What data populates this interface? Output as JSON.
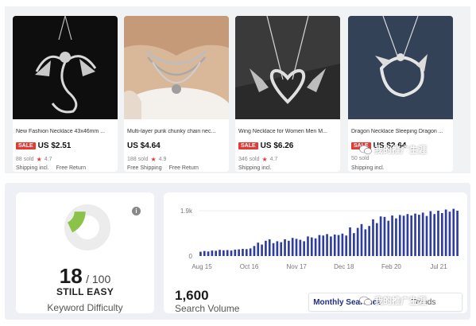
{
  "products": [
    {
      "title": "New Fashion Necklace 43x46mm ...",
      "sale": true,
      "sale_label": "SALE",
      "price": "US $2.51",
      "sold": "88 sold",
      "rating": "4.7",
      "shipping": "Shipping incl.",
      "free_return": "Free Return"
    },
    {
      "title": "Multi-layer punk chunky chain nec...",
      "sale": false,
      "sale_label": "",
      "price": "US $4.64",
      "sold": "188 sold",
      "rating": "4.9",
      "shipping": "Free Shipping",
      "free_return": "Free Return"
    },
    {
      "title": "Wing Necklace for Women Men M...",
      "sale": true,
      "sale_label": "SALE",
      "price": "US $6.26",
      "sold": "346 sold",
      "rating": "4.7",
      "shipping": "Shipping incl.",
      "free_return": ""
    },
    {
      "title": "Dragon Necklace Sleeping Dragon ...",
      "sale": true,
      "sale_label": "SALE",
      "price": "US $2.64",
      "sold": "50 sold",
      "rating": "",
      "shipping": "Shipping incl.",
      "free_return": ""
    }
  ],
  "keyword_difficulty": {
    "score": "18",
    "max": "/ 100",
    "level": "STILL EASY",
    "title": "Keyword Difficulty",
    "info_icon": "info-icon",
    "gauge_fraction": 0.18,
    "gauge_color": "#8bc34a"
  },
  "search_volume": {
    "value": "1,600",
    "title": "Search Volume",
    "tabs": [
      "Monthly Searches",
      "Trends"
    ],
    "active_tab": 0,
    "bar_color": "#2f3d9f"
  },
  "chart_data": {
    "type": "bar",
    "title": "",
    "xlabel": "",
    "ylabel": "",
    "y_ticks": [
      "0",
      "1.9k"
    ],
    "ylim": [
      0,
      2000
    ],
    "x_tick_labels": [
      "Aug 15",
      "Oct 16",
      "Nov 17",
      "Dec 18",
      "Feb 20",
      "Jul 21"
    ],
    "values": [
      180,
      210,
      190,
      230,
      220,
      260,
      240,
      250,
      230,
      270,
      280,
      300,
      290,
      320,
      420,
      560,
      480,
      640,
      700,
      540,
      620,
      580,
      700,
      640,
      760,
      720,
      680,
      620,
      820,
      780,
      740,
      880,
      860,
      920,
      820,
      900,
      880,
      940,
      860,
      1200,
      960,
      1180,
      1340,
      1120,
      1260,
      1540,
      1380,
      1660,
      1640,
      1480,
      1700,
      1580,
      1720,
      1690,
      1760,
      1700,
      1780,
      1730,
      1820,
      1680,
      1880,
      1760,
      1900,
      1800,
      1950,
      1860,
      1980,
      1900
    ]
  },
  "watermark": {
    "text": "我的推广生涯"
  }
}
